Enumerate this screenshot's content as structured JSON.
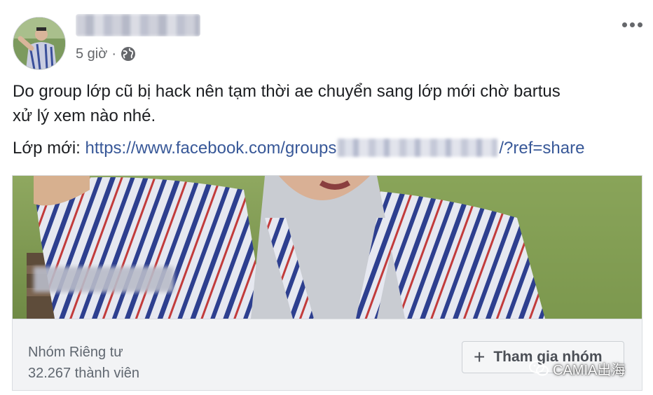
{
  "post": {
    "timestamp": "5 giờ",
    "separator": "·",
    "text_line_1": "Do group lớp cũ bị hack nên tạm thời ae chuyển sang lớp mới chờ bartus",
    "text_line_2": "xử lý xem nào nhé.",
    "link_prefix": "Lớp mới:",
    "link_url_start": "https://www.facebook.com/groups",
    "link_url_end": "/?ref=share"
  },
  "card": {
    "privacy": "Nhóm Riêng tư",
    "members": "32.267 thành viên",
    "join_label": "Tham gia nhóm",
    "join_icon": "+"
  },
  "watermark": {
    "text": "CAMIA出海"
  },
  "icons": {
    "globe": "globe-icon",
    "more": "more-options-icon",
    "watermark": "wechat-icon"
  },
  "colors": {
    "link": "#385898",
    "meta": "#65676b",
    "card_bg": "#f2f3f5"
  }
}
